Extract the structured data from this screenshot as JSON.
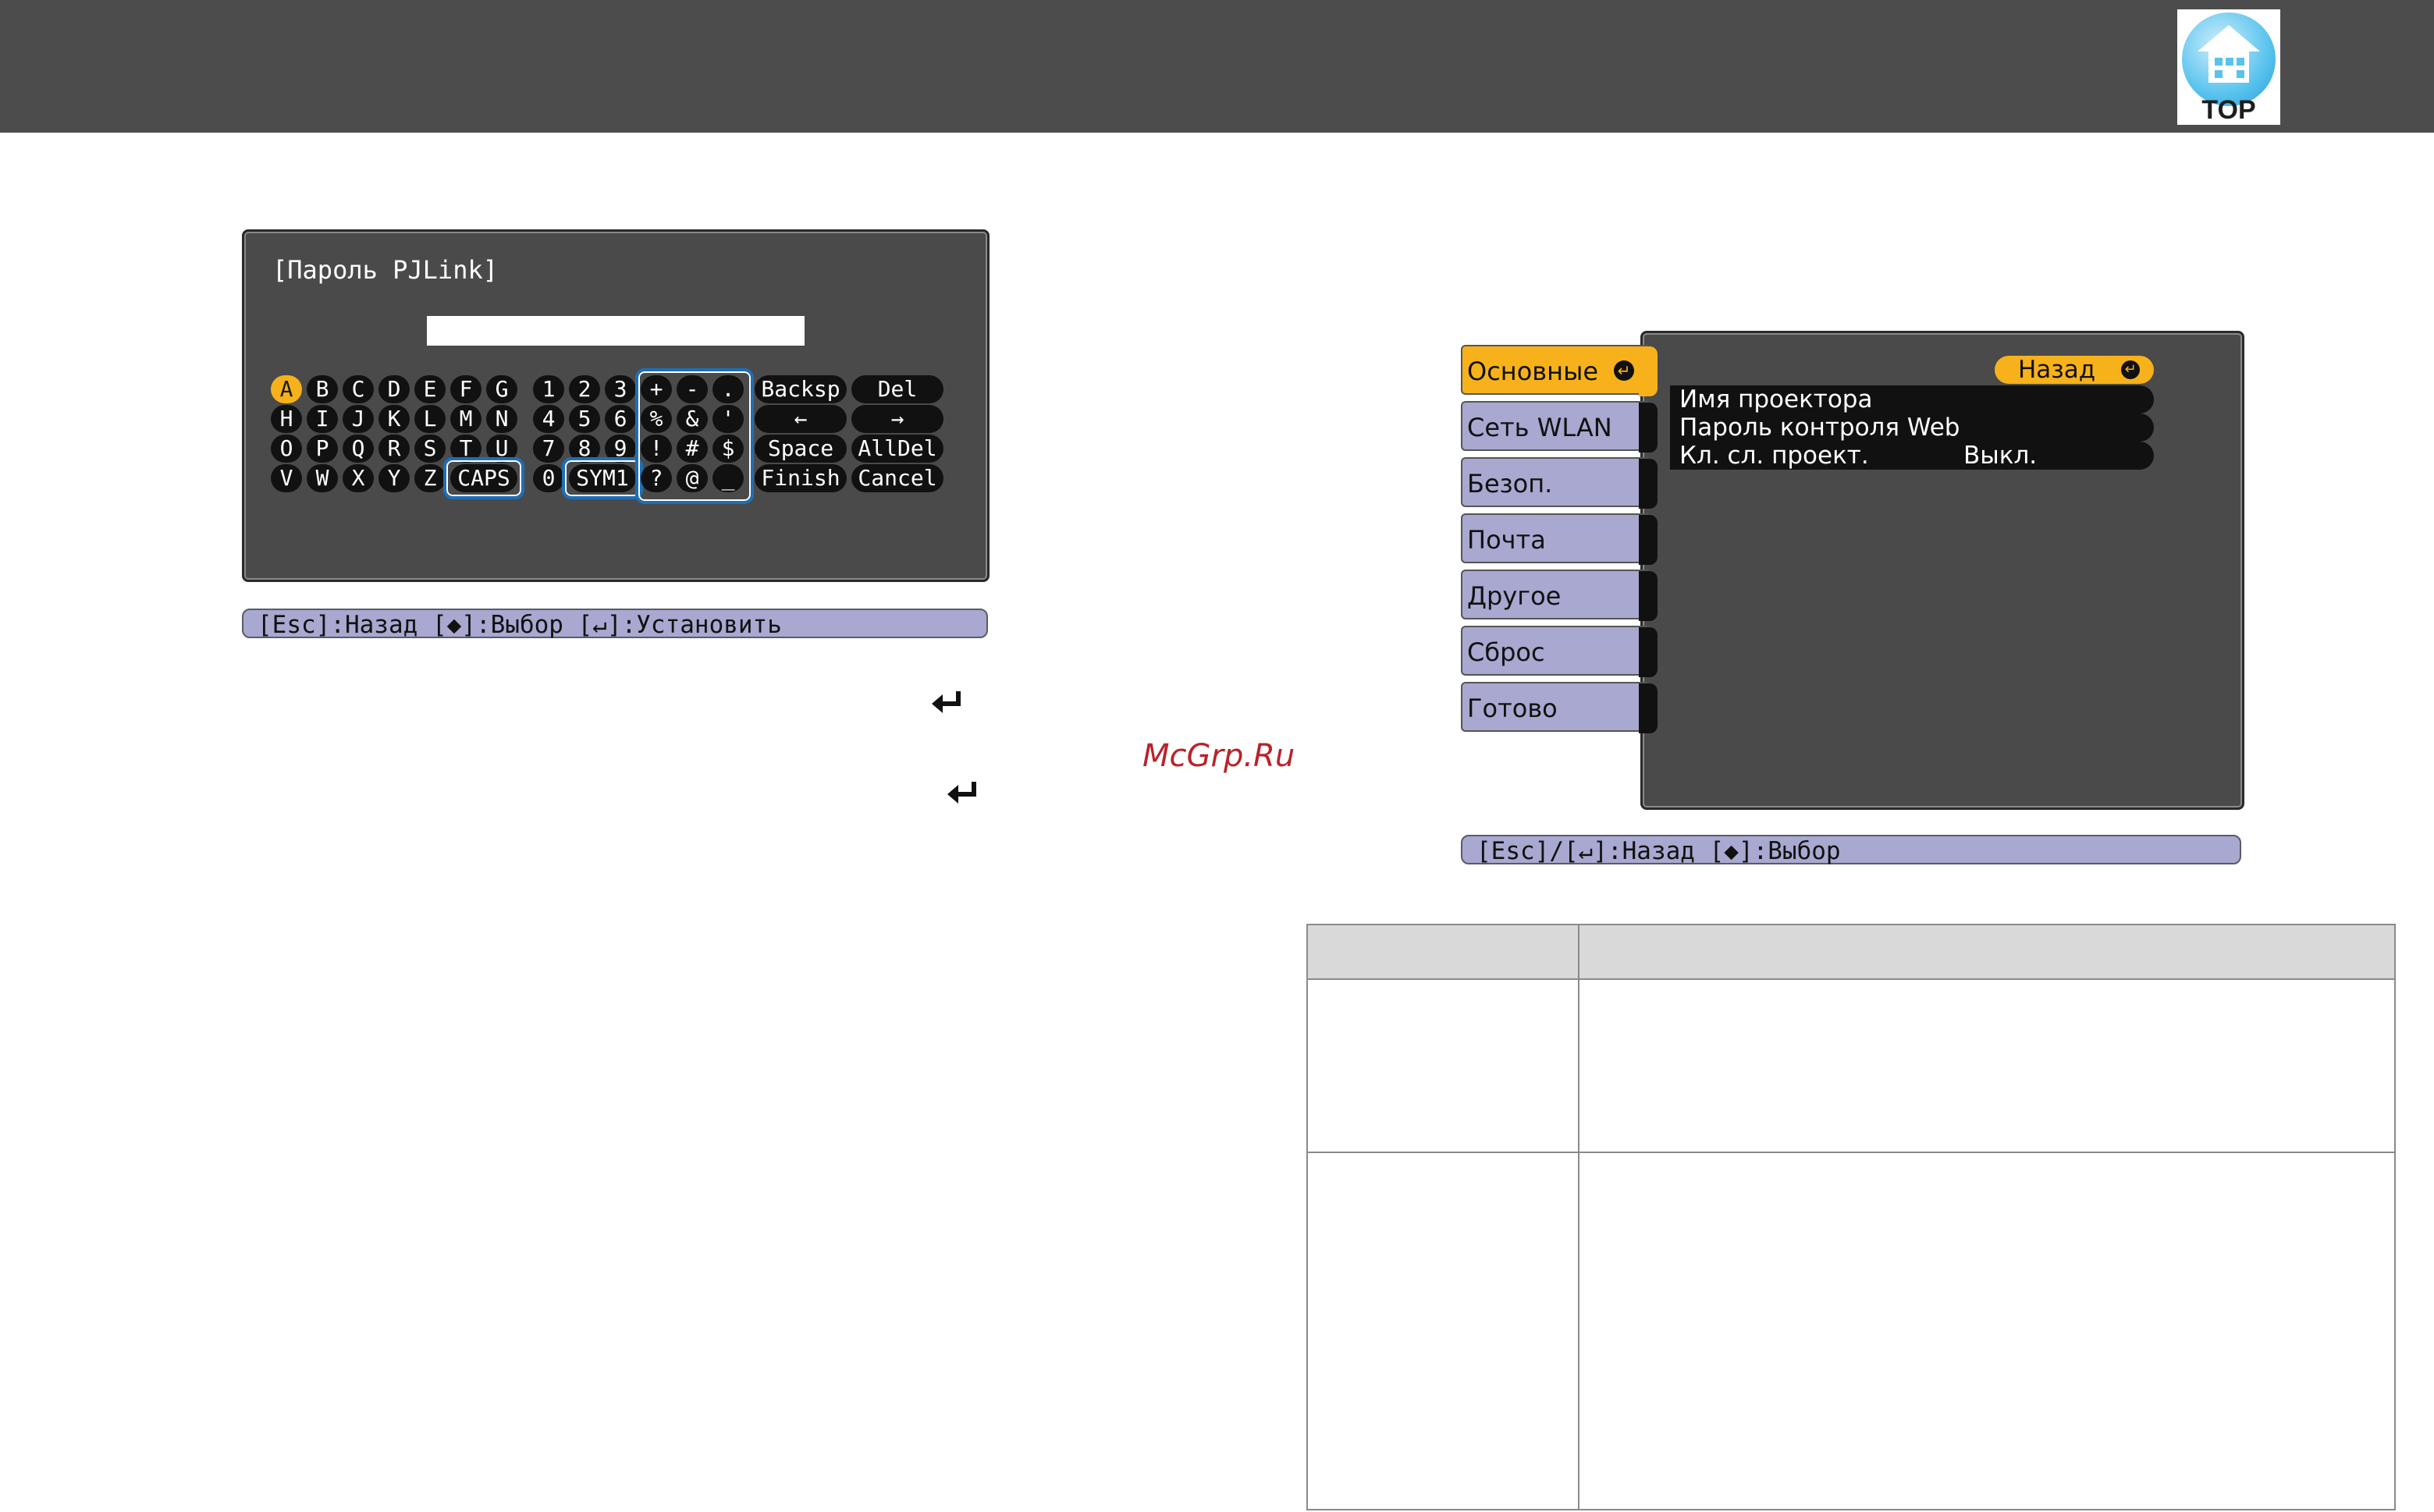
{
  "header": {
    "top_label": "TOP"
  },
  "keyboard_dialog": {
    "title": "[Пароль PJLink]",
    "input_value": "",
    "selected_key": "A",
    "letters": [
      [
        "A",
        "B",
        "C",
        "D",
        "E",
        "F",
        "G"
      ],
      [
        "H",
        "I",
        "J",
        "K",
        "L",
        "M",
        "N"
      ],
      [
        "O",
        "P",
        "Q",
        "R",
        "S",
        "T",
        "U"
      ],
      [
        "V",
        "W",
        "X",
        "Y",
        "Z"
      ]
    ],
    "caps_label": "CAPS",
    "digits": [
      [
        "1",
        "2",
        "3"
      ],
      [
        "4",
        "5",
        "6"
      ],
      [
        "7",
        "8",
        "9"
      ],
      [
        "0"
      ]
    ],
    "sym_label": "SYM1",
    "symbols": [
      [
        "+",
        "-",
        "."
      ],
      [
        "%",
        "&",
        "'"
      ],
      [
        "!",
        "#",
        "$"
      ],
      [
        "?",
        "@",
        "_"
      ]
    ],
    "functions": [
      [
        "Backsp",
        "Del"
      ],
      [
        "←",
        "→"
      ],
      [
        "Space",
        "AllDel"
      ],
      [
        "Finish",
        "Cancel"
      ]
    ]
  },
  "keyboard_guide": "[Esc]:Назад [◆]:Выбор [↵]:Установить",
  "watermark": "McGrp.Ru",
  "menu": {
    "tabs": [
      "Основные",
      "Сеть WLAN",
      "Безоп.",
      "Почта",
      "Другое",
      "Сброс",
      "Готово"
    ],
    "active_tab": 0,
    "back_label": "Назад",
    "items": [
      {
        "label": "Имя проектора",
        "value": ""
      },
      {
        "label": "Пароль контроля Web",
        "value": ""
      },
      {
        "label": "Кл. сл. проект.",
        "value": "Выкл."
      }
    ]
  },
  "menu_guide": "[Esc]/[↵]:Назад [◆]:Выбор",
  "colors": {
    "topbar": "#4c4c4c",
    "panel": "#4a4a4a",
    "highlight": "#f7b21b",
    "tab": "#a8a8d0",
    "outline": "#1e6fb5"
  }
}
